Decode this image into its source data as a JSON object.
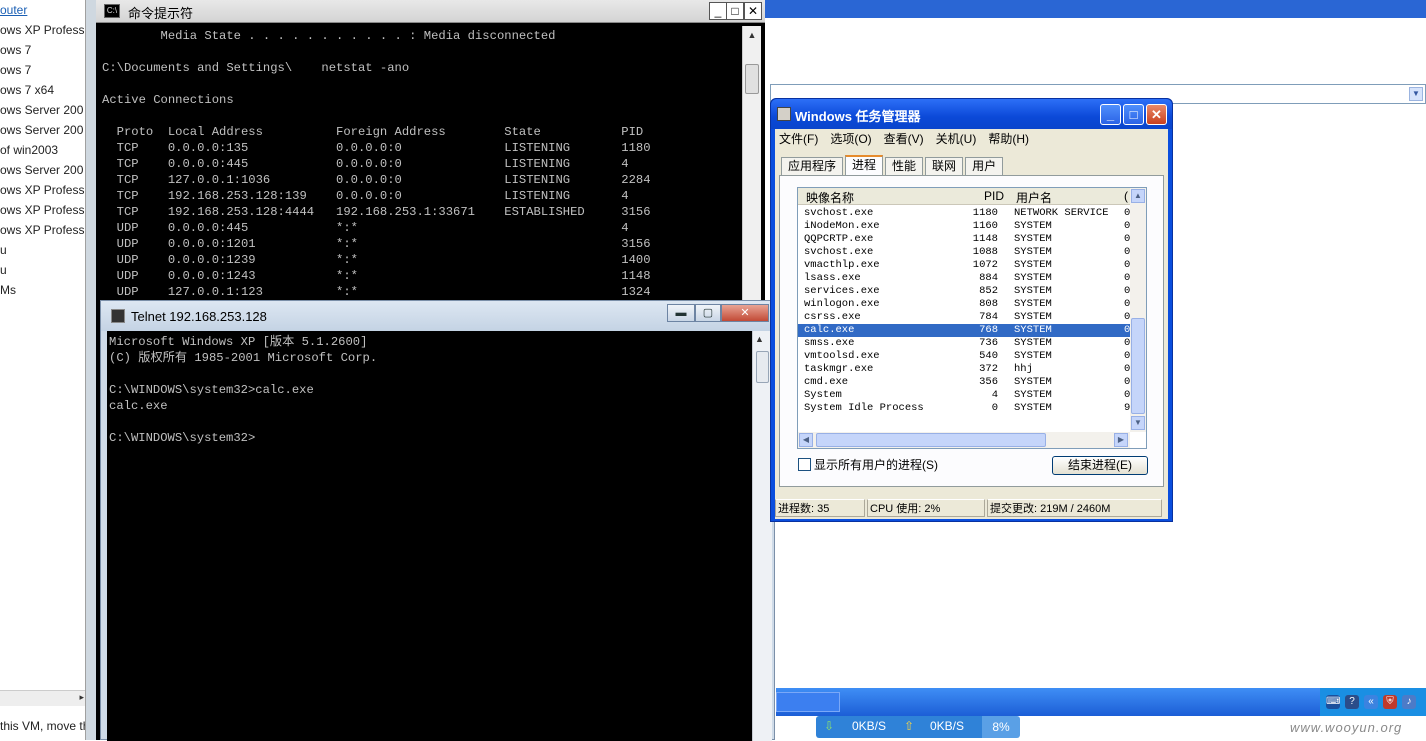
{
  "sidebar": {
    "items": [
      "outer",
      "ows XP Profess",
      "ows 7",
      "ows 7",
      "ows 7 x64",
      "ows Server 200",
      "ows Server 200",
      "of win2003",
      "ows Server 200",
      "ows XP Profess",
      "ows XP Profess",
      "ows XP Profess",
      "u",
      "u",
      "Ms"
    ],
    "status_text": "this VM, move the"
  },
  "cmd_window": {
    "title": "命令提示符",
    "icon": "cmd-icon",
    "minimize": "_",
    "maximize": "□",
    "close": "✕",
    "lines": [
      "        Media State . . . . . . . . . . . : Media disconnected",
      "",
      "C:\\Documents and Settings\\    netstat -ano",
      "",
      "Active Connections",
      "",
      "  Proto  Local Address          Foreign Address        State           PID",
      "  TCP    0.0.0.0:135            0.0.0.0:0              LISTENING       1180",
      "  TCP    0.0.0.0:445            0.0.0.0:0              LISTENING       4",
      "  TCP    127.0.0.1:1036         0.0.0.0:0              LISTENING       2284",
      "  TCP    192.168.253.128:139    0.0.0.0:0              LISTENING       4",
      "  TCP    192.168.253.128:4444   192.168.253.1:33671    ESTABLISHED     3156",
      "  UDP    0.0.0.0:445            *:*                                    4",
      "  UDP    0.0.0.0:1201           *:*                                    3156",
      "  UDP    0.0.0.0:1239           *:*                                    1400",
      "  UDP    0.0.0.0:1243           *:*                                    1148",
      "  UDP    127.0.0.1:123          *:*                                    1324"
    ]
  },
  "telnet_window": {
    "title": "Telnet 192.168.253.128",
    "minimize": "▬",
    "maximize": "▢",
    "close": "✕",
    "lines": [
      "Microsoft Windows XP [版本 5.1.2600]",
      "(C) 版权所有 1985-2001 Microsoft Corp.",
      "",
      "C:\\WINDOWS\\system32>calc.exe",
      "calc.exe",
      "",
      "C:\\WINDOWS\\system32>"
    ]
  },
  "task_manager": {
    "title": "Windows 任务管理器",
    "menu": [
      "文件(F)",
      "选项(O)",
      "查看(V)",
      "关机(U)",
      "帮助(H)"
    ],
    "tabs": [
      "应用程序",
      "进程",
      "性能",
      "联网",
      "用户"
    ],
    "selected_tab": "进程",
    "columns": [
      "映像名称",
      "PID",
      "用户名",
      "("
    ],
    "rows": [
      {
        "name": "svchost.exe",
        "pid": "1180",
        "user": "NETWORK SERVICE",
        "extra": "0"
      },
      {
        "name": "iNodeMon.exe",
        "pid": "1160",
        "user": "SYSTEM",
        "extra": "0"
      },
      {
        "name": "QQPCRTP.exe",
        "pid": "1148",
        "user": "SYSTEM",
        "extra": "0"
      },
      {
        "name": "svchost.exe",
        "pid": "1088",
        "user": "SYSTEM",
        "extra": "0"
      },
      {
        "name": "vmacthlp.exe",
        "pid": "1072",
        "user": "SYSTEM",
        "extra": "0"
      },
      {
        "name": "lsass.exe",
        "pid": "884",
        "user": "SYSTEM",
        "extra": "0"
      },
      {
        "name": "services.exe",
        "pid": "852",
        "user": "SYSTEM",
        "extra": "0"
      },
      {
        "name": "winlogon.exe",
        "pid": "808",
        "user": "SYSTEM",
        "extra": "0"
      },
      {
        "name": "csrss.exe",
        "pid": "784",
        "user": "SYSTEM",
        "extra": "0"
      },
      {
        "name": "calc.exe",
        "pid": "768",
        "user": "SYSTEM",
        "extra": "0"
      },
      {
        "name": "smss.exe",
        "pid": "736",
        "user": "SYSTEM",
        "extra": "0"
      },
      {
        "name": "vmtoolsd.exe",
        "pid": "540",
        "user": "SYSTEM",
        "extra": "0"
      },
      {
        "name": "taskmgr.exe",
        "pid": "372",
        "user": "hhj",
        "extra": "0"
      },
      {
        "name": "cmd.exe",
        "pid": "356",
        "user": "SYSTEM",
        "extra": "0"
      },
      {
        "name": "System",
        "pid": "4",
        "user": "SYSTEM",
        "extra": "0"
      },
      {
        "name": "System Idle Process",
        "pid": "0",
        "user": "SYSTEM",
        "extra": "9"
      }
    ],
    "selected_row": "calc.exe",
    "show_all_users": "显示所有用户的进程(S)",
    "end_process": "结束进程(E)",
    "status": {
      "processes": "进程数: 35",
      "cpu": "CPU 使用: 2%",
      "commit": "提交更改: 219M / 2460M"
    }
  },
  "netbar": {
    "down": "0KB/S",
    "up": "0KB/S",
    "percent": "8%"
  },
  "watermark": "www.wooyun.org",
  "colors": {
    "xp_blue": "#0a4ede",
    "selection": "#316ac5",
    "cmd_text": "#c0c0c0"
  }
}
